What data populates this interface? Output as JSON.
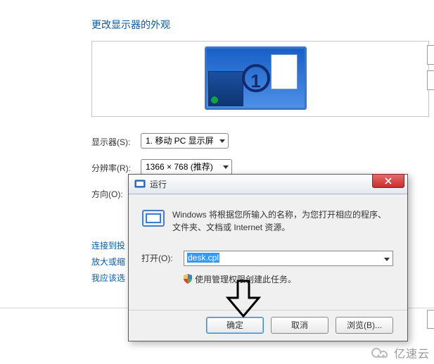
{
  "page": {
    "title": "更改显示器的外观",
    "monitor_number": "1"
  },
  "form": {
    "display_label": "显示器(S):",
    "display_value": "1. 移动 PC 显示屏",
    "resolution_label": "分辨率(R):",
    "resolution_value": "1366 × 768 (推荐)",
    "orientation_label": "方向(O):"
  },
  "links": {
    "connect_projector": "连接到投",
    "enlarge": "放大或缩",
    "what_settings": "我应该选"
  },
  "run": {
    "title": "运行",
    "description": "Windows 将根据您所输入的名称，为您打开相应的程序、文件夹、文档或 Internet 资源。",
    "open_label": "打开(O):",
    "open_value": "desk.cpl",
    "admin_note": "使用管理权限创建此任务。",
    "ok": "确定",
    "cancel": "取消",
    "browse": "浏览(B)..."
  },
  "watermark": "亿速云"
}
